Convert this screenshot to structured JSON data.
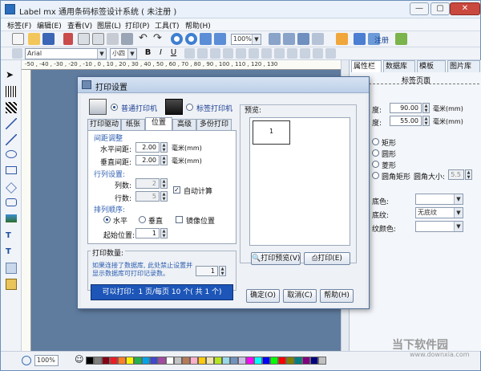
{
  "window": {
    "title": "Label mx 通用条码标签设计系统 ( 未注册 )",
    "controls": {
      "minimize": "—",
      "maximize": "▢",
      "close": "✕"
    }
  },
  "menu": [
    "标签(F)",
    "编辑(E)",
    "查看(V)",
    "图层(L)",
    "打印(P)",
    "工具(T)",
    "帮助(H)"
  ],
  "toolbar": {
    "zoom": "100%",
    "register": "注册",
    "font": "Arial",
    "size": "小四"
  },
  "ruler": {
    "ticks": "-50 , -40 , -30 , -20 , -10 , 0 , 10 , 20 , 30 , 40 , 50 , 60 , 70 , 80 , 90 , 100 , 110 , 120 , 130"
  },
  "right_panel": {
    "tabs": [
      "属性栏",
      "数据库",
      "模板",
      "图片库"
    ],
    "section": "标签页面",
    "width_label": "度:",
    "width_value": "90.00",
    "height_label": "度:",
    "height_value": "55.00",
    "unit": "毫米(mm)",
    "shapes": [
      "矩形",
      "圆形",
      "菱形",
      "圆角矩形"
    ],
    "corner_label": "圆角大小:",
    "corner_value": "5.5",
    "bg_color_label": "底色:",
    "bg_texture_label": "底纹:",
    "bg_texture_value": "无底纹",
    "border_color_label": "纹颜色:"
  },
  "status": {
    "zoom": "100%"
  },
  "palette": [
    "#000000",
    "#7f7f7f",
    "#880015",
    "#ed1c24",
    "#ff7f27",
    "#fff200",
    "#22b14c",
    "#00a2e8",
    "#3f48cc",
    "#a349a4",
    "#ffffff",
    "#c3c3c3",
    "#b97a57",
    "#ffaec9",
    "#ffc90e",
    "#efe4b0",
    "#b5e61d",
    "#99d9ea",
    "#7092be",
    "#c8bfe7",
    "#ff00ff",
    "#00ffff",
    "#0000ff",
    "#00ff00",
    "#ff0000",
    "#808000",
    "#008080",
    "#800080",
    "#000080",
    "#c0c0c0"
  ],
  "dialog": {
    "title": "打印设置",
    "printer_options": [
      "普通打印机",
      "标签打印机"
    ],
    "tabs": [
      "打印驱动",
      "纸张",
      "位置",
      "高级",
      "多份打印"
    ],
    "margin_section": "间距调整",
    "h_margin_label": "水平间距:",
    "h_margin_value": "2.00",
    "v_margin_label": "垂直间距:",
    "v_margin_value": "2.00",
    "unit": "毫米(mm)",
    "rowcol_section": "行列设置:",
    "cols_label": "列数:",
    "cols_value": "2",
    "rows_label": "行数:",
    "rows_value": "5",
    "auto_calc": "自动计算",
    "order_section": "排列顺序:",
    "order_options": [
      "水平",
      "垂直"
    ],
    "mirror": "镜像位置",
    "start_label": "起始位置:",
    "start_value": "1",
    "print_qty_section": "打印数量:",
    "print_qty_note": "如果连接了数据库, 此处禁止设置并显示数据库可打印记录数。",
    "print_qty_value": "1",
    "print_info": "可以打印：1 页/每页 10 个( 共 1 个)",
    "preview_label": "预览:",
    "preview_number": "1",
    "preview_button": "打印预览(V)",
    "print_button": "打印(E)",
    "ok": "确定(O)",
    "cancel": "取消(C)",
    "help": "帮助(H)"
  },
  "watermark": {
    "title": "当下软件园",
    "url": "www.downxia.com"
  }
}
